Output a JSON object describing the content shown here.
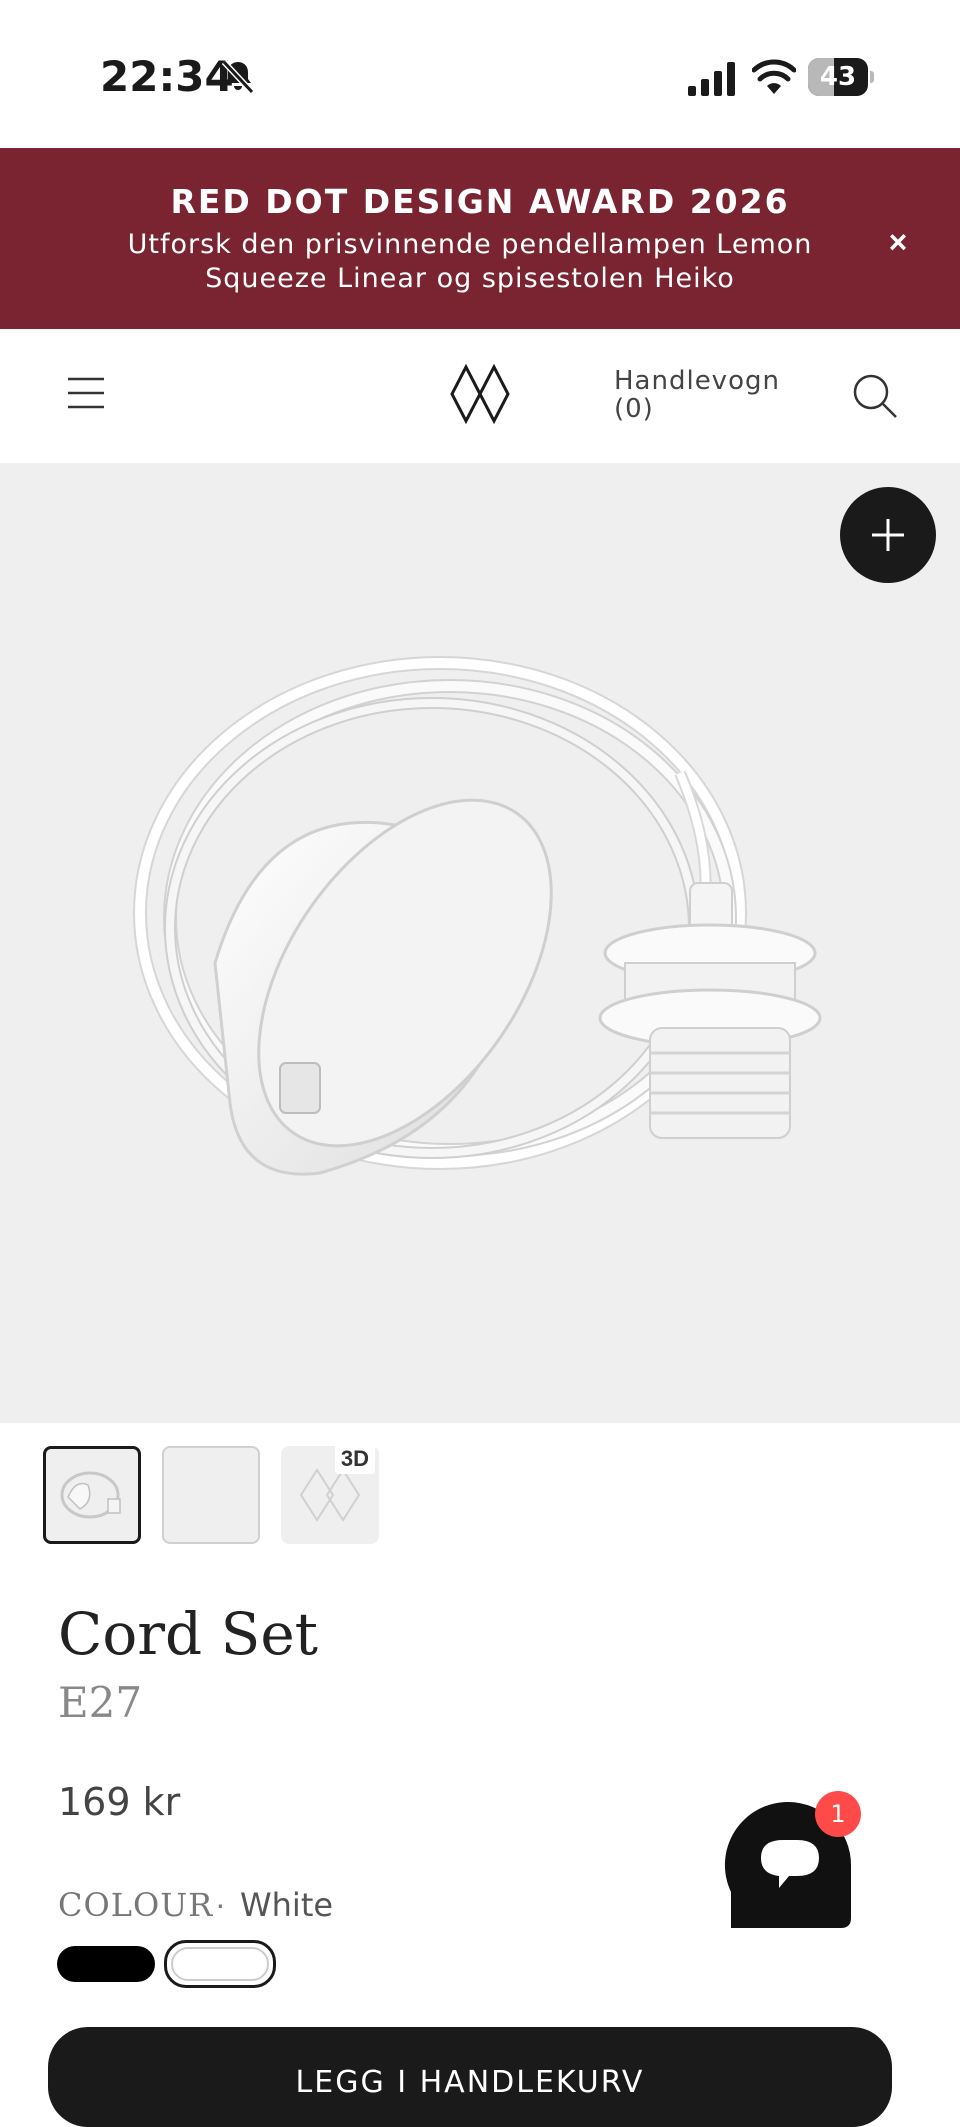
{
  "status_bar": {
    "time": "22:34",
    "battery_level": "43",
    "battery_fraction": 0.43
  },
  "announcement": {
    "title": "RED DOT DESIGN AWARD 2026",
    "subtitle": "Utforsk den prisvinnende pendellampen Lemon Squeeze Linear og spisestolen Heiko",
    "close_label": "×",
    "background_color": "#7a2331"
  },
  "header": {
    "cart_label": "Handlevogn",
    "cart_count": "(0)"
  },
  "gallery": {
    "thumbnails": [
      {
        "kind": "image"
      },
      {
        "kind": "image"
      },
      {
        "kind": "3d",
        "badge": "3D"
      }
    ]
  },
  "product": {
    "name": "Cord Set",
    "variant": "E27",
    "price": "169 kr",
    "colour_label": "COLOUR",
    "colour_separator": "·",
    "colour_value": "White",
    "swatches": [
      {
        "name": "Black",
        "color": "#000000",
        "selected": false
      },
      {
        "name": "White",
        "color": "#ffffff",
        "selected": true
      }
    ],
    "add_to_cart": "LEGG I HANDLEKURV"
  },
  "chat": {
    "unread_count": "1"
  },
  "icons": [
    "bell-slash-icon",
    "signal-icon",
    "wifi-icon",
    "battery-icon",
    "close-icon",
    "hamburger-menu-icon",
    "brand-logo-icon",
    "search-icon",
    "plus-icon",
    "chat-bubble-icon"
  ]
}
